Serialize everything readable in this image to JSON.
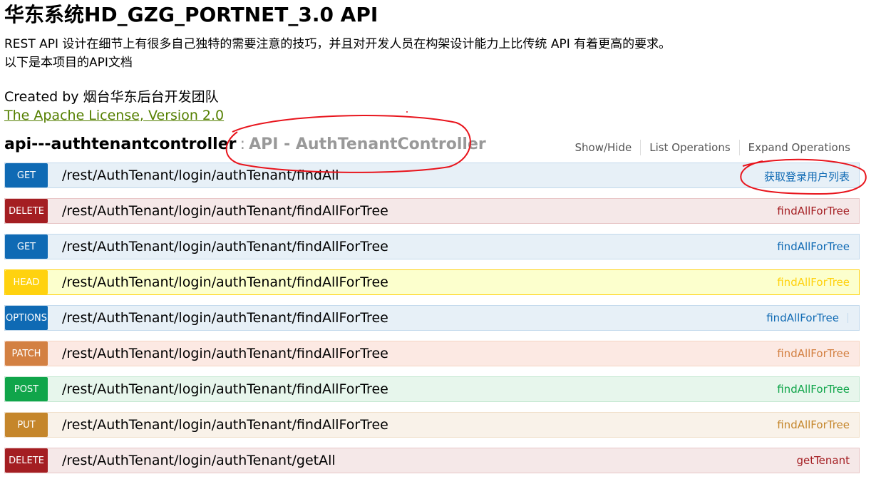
{
  "info": {
    "title": "华东系统HD_GZG_PORTNET_3.0 API",
    "description_lines": [
      "REST API 设计在细节上有很多自己独特的需要注意的技巧，并且对开发人员在构架设计能力上比传统 API 有着更高的要求。",
      "以下是本项目的API文档"
    ],
    "created_by": "Created by 烟台华东后台开发团队",
    "license": "The Apache License, Version 2.0"
  },
  "section": {
    "name": "api---authtenantcontroller",
    "separator": ":",
    "description": "API - AuthTenantController",
    "links": {
      "show_hide": "Show/Hide",
      "list_operations": "List Operations",
      "expand_operations": "Expand Operations"
    }
  },
  "operations": [
    {
      "method": "GET",
      "path": "/rest/AuthTenant/login/authTenant/findAll",
      "summary": "获取登录用户列表"
    },
    {
      "method": "DELETE",
      "path": "/rest/AuthTenant/login/authTenant/findAllForTree",
      "summary": "findAllForTree"
    },
    {
      "method": "GET",
      "path": "/rest/AuthTenant/login/authTenant/findAllForTree",
      "summary": "findAllForTree"
    },
    {
      "method": "HEAD",
      "path": "/rest/AuthTenant/login/authTenant/findAllForTree",
      "summary": "findAllForTree"
    },
    {
      "method": "OPTIONS",
      "path": "/rest/AuthTenant/login/authTenant/findAllForTree",
      "summary": "findAllForTree"
    },
    {
      "method": "PATCH",
      "path": "/rest/AuthTenant/login/authTenant/findAllForTree",
      "summary": "findAllForTree"
    },
    {
      "method": "POST",
      "path": "/rest/AuthTenant/login/authTenant/findAllForTree",
      "summary": "findAllForTree"
    },
    {
      "method": "PUT",
      "path": "/rest/AuthTenant/login/authTenant/findAllForTree",
      "summary": "findAllForTree"
    },
    {
      "method": "DELETE",
      "path": "/rest/AuthTenant/login/authTenant/getAll",
      "summary": "getTenant"
    }
  ],
  "colors": {
    "get": "#0f6ab4",
    "delete": "#a41e22",
    "head": "#ffd20f",
    "options": "#0f6ab4",
    "patch": "#d38042",
    "post": "#10a54a",
    "put": "#c5862b",
    "license_link": "#547f00",
    "annotation": "#e8141c"
  }
}
